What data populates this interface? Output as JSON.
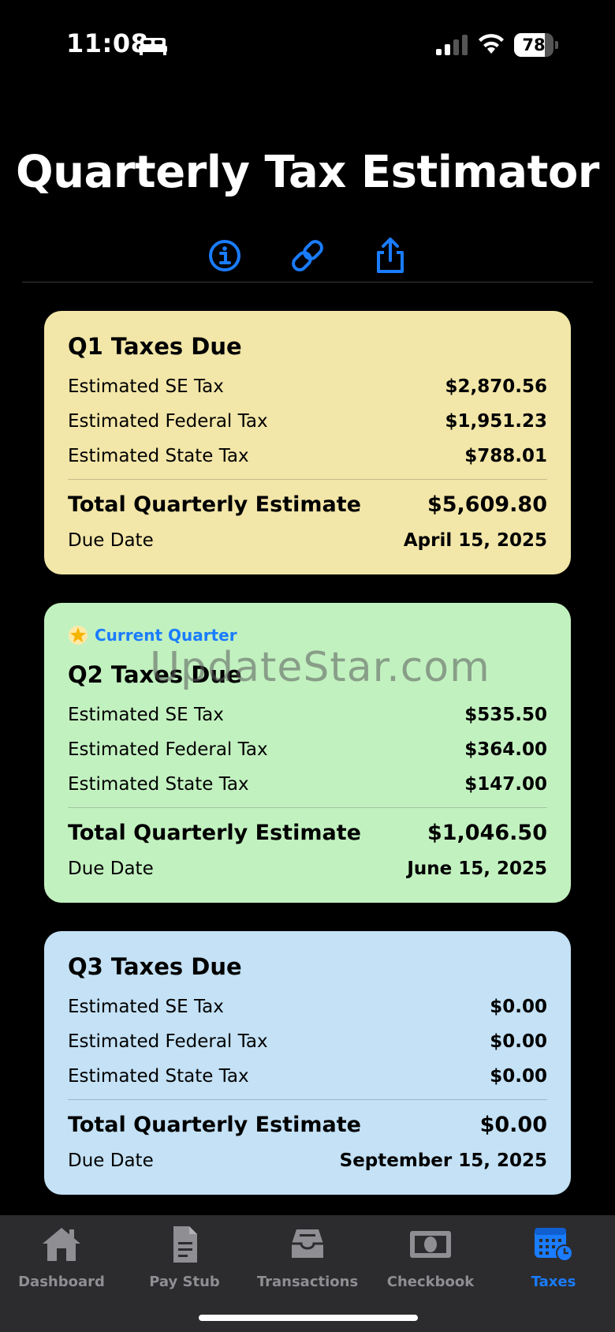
{
  "status": {
    "time": "11:08",
    "battery": "78",
    "battery_level": 0.78
  },
  "page": {
    "title": "Quarterly Tax Estimator"
  },
  "toolbar": {
    "icons": [
      "info-icon",
      "link-icon",
      "share-icon"
    ]
  },
  "quarters": [
    {
      "title": "Q1 Taxes Due",
      "color": "#f2e6a8",
      "se_label": "Estimated SE Tax",
      "se_value": "$2,870.56",
      "fed_label": "Estimated Federal Tax",
      "fed_value": "$1,951.23",
      "state_label": "Estimated State Tax",
      "state_value": "$788.01",
      "total_label": "Total Quarterly Estimate",
      "total_value": "$5,609.80",
      "due_label": "Due Date",
      "due_value": "April 15, 2025"
    },
    {
      "badge": "Current Quarter",
      "title": "Q2 Taxes Due",
      "color": "#c2f1c0",
      "se_label": "Estimated SE Tax",
      "se_value": "$535.50",
      "fed_label": "Estimated Federal Tax",
      "fed_value": "$364.00",
      "state_label": "Estimated State Tax",
      "state_value": "$147.00",
      "total_label": "Total Quarterly Estimate",
      "total_value": "$1,046.50",
      "due_label": "Due Date",
      "due_value": "June 15, 2025"
    },
    {
      "title": "Q3 Taxes Due",
      "color": "#c4e1f5",
      "se_label": "Estimated SE Tax",
      "se_value": "$0.00",
      "fed_label": "Estimated Federal Tax",
      "fed_value": "$0.00",
      "state_label": "Estimated State Tax",
      "state_value": "$0.00",
      "total_label": "Total Quarterly Estimate",
      "total_value": "$0.00",
      "due_label": "Due Date",
      "due_value": "September 15, 2025"
    }
  ],
  "watermark": "UpdateStar.com",
  "tabs": [
    {
      "label": "Dashboard",
      "icon": "house-icon"
    },
    {
      "label": "Pay Stub",
      "icon": "document-icon"
    },
    {
      "label": "Transactions",
      "icon": "tray-icon"
    },
    {
      "label": "Checkbook",
      "icon": "banknote-icon"
    },
    {
      "label": "Taxes",
      "icon": "calendar-clock-icon",
      "active": true
    }
  ],
  "colors": {
    "accent": "#1a7cff",
    "tab_inactive": "#8e8e93"
  }
}
